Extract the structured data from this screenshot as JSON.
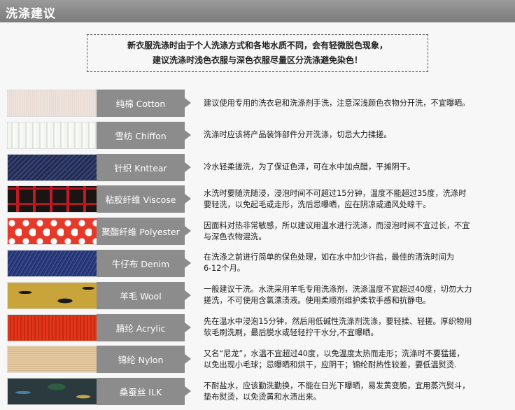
{
  "header": {
    "title": "洗涤建议"
  },
  "notice": {
    "line1": "新衣服洗涤时由于个人洗涤方式和各地水质不同，会有轻微脱色现象，",
    "line2": "建议洗涤时浅色衣服与深色衣服尽量区分洗涤避免染色！"
  },
  "fabrics": [
    {
      "label": "纯棉 Cotton",
      "swatch": "cotton-swatch",
      "lines": [
        "建议使用专用的洗衣皂和洗涤剂手洗，注意深浅颜色衣物分开洗，不宜曝晒。"
      ]
    },
    {
      "label": "雪纺 Chiffon",
      "swatch": "chiffon-swatch",
      "lines": [
        "洗涤时应该将产品装饰部件分开洗涤，切忌大力揉搓。"
      ]
    },
    {
      "label": "针织 Knttear",
      "swatch": "knit-swatch",
      "lines": [
        "冷水轻柔搓洗，为了保证色泽，可在水中加点醋，平摊阴干。"
      ]
    },
    {
      "label": "粘胶纤维 Viscose",
      "swatch": "viscose-swatch",
      "lines": [
        "水洗时要随洗随浸，浸泡时间不可超过15分钟，温度不能超过35度，洗涤时",
        "要轻洗，以免起毛或走形，洗后忌曝晒，应在阴凉或通风处晾干。"
      ]
    },
    {
      "label": "聚酯纤维 Polyester",
      "swatch": "polyester-swatch",
      "lines": [
        "因面料对热非常敏感，所以建议用温水进行洗涤，而浸泡时间不宜过长，不宜",
        "与深色衣物混洗。"
      ]
    },
    {
      "label": "牛仔布 Denim",
      "swatch": "denim-swatch",
      "lines": [
        "在洗涤之前进行简单的保色处理，如在水中加少许盐，最佳的清洗时间为",
        "6-12个月。"
      ]
    },
    {
      "label": "羊毛 Wool",
      "swatch": "wool-swatch",
      "lines": [
        "一般建议干洗。水洗采用羊毛专用洗涤剂，洗涤温度不宜超过40度，切勿大力",
        "搓洗，不可使用含氯漂渍液。使用柔顺剂维护柔软手感和抗静电。"
      ]
    },
    {
      "label": "腈纶 Acrylic",
      "swatch": "acrylic-swatch",
      "lines": [
        "先在温水中浸泡15分钟，然后用低碱性洗涤剂洗涤，要轻揉、轻搓。厚织物用",
        "软毛刷洗刷，最后脱水或轻轻拧干水分,不宜曝晒。"
      ]
    },
    {
      "label": "锦纶 Nylon",
      "swatch": "nylon-swatch",
      "lines": [
        "又名“尼龙”，水温不宜超过40度，以免温度太热而走形；洗涤时不要猛搓，",
        "以免出现小毛球；忌曝晒和烘干，应阴干；锦纶耐热性较差，要低温熨烫."
      ]
    },
    {
      "label": "桑蚕丝 ILK",
      "swatch": "silk-swatch",
      "lines": [
        "不耐盐水，应该勤洗勤换，不能在日光下曝晒，易发黄变脆，宜用蒸汽熨斗，",
        "垫布熨烫，以免烫黄和水渍出来。"
      ]
    }
  ]
}
